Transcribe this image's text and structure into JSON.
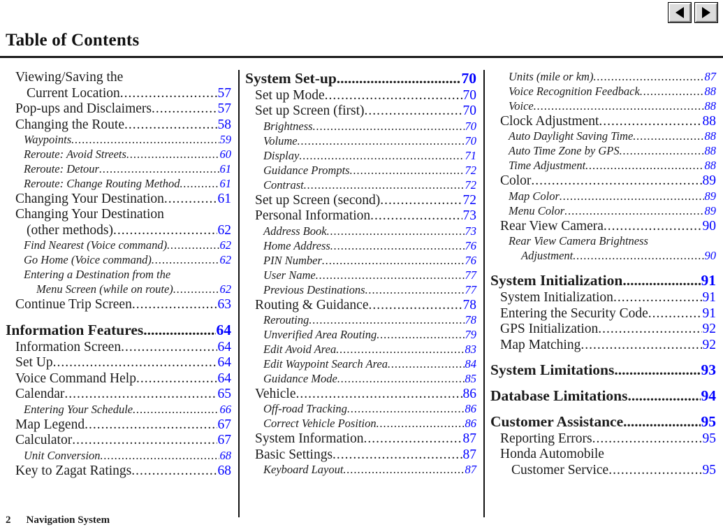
{
  "document": {
    "title": "Table of Contents",
    "footer_page_number": "2",
    "footer_title": "Navigation System"
  },
  "nav": {
    "prev_icon": "triangle-left-icon",
    "next_icon": "triangle-right-icon"
  },
  "colors": {
    "page_number": "#0000FF",
    "text": "#1B1B1B",
    "rule": "#1A1A1A"
  },
  "columns": [
    {
      "id": "column-1",
      "entries": [
        {
          "level": "1",
          "label": "Viewing/Saving the",
          "label2": "Current Location",
          "page": "57",
          "wrapped": true
        },
        {
          "level": "1",
          "label": "Pop-ups and Disclaimers",
          "page": "57"
        },
        {
          "level": "1",
          "label": "Changing the Route",
          "page": "58"
        },
        {
          "level": "2",
          "label": "Waypoints",
          "page": "59"
        },
        {
          "level": "2",
          "label": "Reroute: Avoid Streets",
          "page": "60"
        },
        {
          "level": "2",
          "label": "Reroute: Detour",
          "page": "61"
        },
        {
          "level": "2",
          "label": "Reroute: Change Routing Method",
          "page": "61"
        },
        {
          "level": "1",
          "label": "Changing Your Destination",
          "page": "61"
        },
        {
          "level": "1",
          "label": "Changing Your Destination",
          "label2": "(other methods)",
          "page": "62",
          "wrapped": true
        },
        {
          "level": "2",
          "label": "Find Nearest (Voice command)",
          "page": "62"
        },
        {
          "level": "2",
          "label": "Go Home (Voice command)",
          "page": "62"
        },
        {
          "level": "2",
          "label": "Entering a Destination from the",
          "label2": "Menu Screen (while on route)",
          "page": "62",
          "wrapped": true
        },
        {
          "level": "1",
          "label": "Continue Trip Screen",
          "page": "63"
        },
        {
          "level": "chapter",
          "label": "Information Features",
          "page": "64"
        },
        {
          "level": "1",
          "label": "Information Screen",
          "page": "64"
        },
        {
          "level": "1",
          "label": "Set Up",
          "page": "64"
        },
        {
          "level": "1",
          "label": "Voice Command Help",
          "page": "64"
        },
        {
          "level": "1",
          "label": "Calendar",
          "page": "65"
        },
        {
          "level": "2",
          "label": "Entering Your Schedule",
          "page": "66"
        },
        {
          "level": "1",
          "label": "Map Legend",
          "page": "67"
        },
        {
          "level": "1",
          "label": "Calculator",
          "page": "67"
        },
        {
          "level": "2",
          "label": "Unit Conversion",
          "page": "68"
        },
        {
          "level": "1",
          "label": "Key to Zagat Ratings",
          "page": "68"
        }
      ]
    },
    {
      "id": "column-2",
      "entries": [
        {
          "level": "chapter",
          "label": "System Set-up",
          "page": "70",
          "first": true
        },
        {
          "level": "1",
          "label": "Set up Mode",
          "page": "70"
        },
        {
          "level": "1",
          "label": "Set up Screen (first)",
          "page": "70"
        },
        {
          "level": "2",
          "label": "Brightness",
          "page": "70"
        },
        {
          "level": "2",
          "label": "Volume",
          "page": "70"
        },
        {
          "level": "2",
          "label": "Display",
          "page": "71"
        },
        {
          "level": "2",
          "label": "Guidance Prompts",
          "page": "72"
        },
        {
          "level": "2",
          "label": "Contrast",
          "page": "72"
        },
        {
          "level": "1",
          "label": "Set up Screen (second)",
          "page": "72"
        },
        {
          "level": "1",
          "label": "Personal Information",
          "page": "73"
        },
        {
          "level": "2",
          "label": "Address Book",
          "page": "73"
        },
        {
          "level": "2",
          "label": "Home Address",
          "page": "76"
        },
        {
          "level": "2",
          "label": "PIN Number",
          "page": "76"
        },
        {
          "level": "2",
          "label": "User Name",
          "page": "77"
        },
        {
          "level": "2",
          "label": "Previous Destinations",
          "page": "77"
        },
        {
          "level": "1",
          "label": "Routing & Guidance",
          "page": "78"
        },
        {
          "level": "2",
          "label": "Rerouting",
          "page": "78"
        },
        {
          "level": "2",
          "label": "Unverified Area Routing",
          "page": "79"
        },
        {
          "level": "2",
          "label": "Edit Avoid Area",
          "page": "83"
        },
        {
          "level": "2",
          "label": "Edit Waypoint Search Area",
          "page": "84"
        },
        {
          "level": "2",
          "label": "Guidance Mode",
          "page": "85"
        },
        {
          "level": "1",
          "label": "Vehicle",
          "page": "86"
        },
        {
          "level": "2",
          "label": "Off-road Tracking",
          "page": "86"
        },
        {
          "level": "2",
          "label": "Correct Vehicle Position",
          "page": "86"
        },
        {
          "level": "1",
          "label": "System Information",
          "page": "87"
        },
        {
          "level": "1",
          "label": "Basic Settings",
          "page": "87"
        },
        {
          "level": "2",
          "label": "Keyboard Layout",
          "page": "87"
        }
      ]
    },
    {
      "id": "column-3",
      "entries": [
        {
          "level": "2",
          "label": "Units (mile or km)",
          "page": "87",
          "first": true
        },
        {
          "level": "2",
          "label": "Voice Recognition Feedback",
          "page": "88"
        },
        {
          "level": "2",
          "label": "Voice",
          "page": "88"
        },
        {
          "level": "1",
          "label": "Clock Adjustment",
          "page": "88"
        },
        {
          "level": "2",
          "label": "Auto Daylight Saving Time",
          "page": "88"
        },
        {
          "level": "2",
          "label": "Auto Time Zone by GPS",
          "page": "88"
        },
        {
          "level": "2",
          "label": "Time Adjustment",
          "page": "88"
        },
        {
          "level": "1",
          "label": "Color",
          "page": "89"
        },
        {
          "level": "2",
          "label": "Map Color",
          "page": "89"
        },
        {
          "level": "2",
          "label": "Menu Color",
          "page": "89"
        },
        {
          "level": "1",
          "label": "Rear View Camera",
          "page": "90"
        },
        {
          "level": "2",
          "label": "Rear View Camera Brightness",
          "label2": "Adjustment",
          "page": "90",
          "wrapped": true
        },
        {
          "level": "chapter",
          "label": "System Initialization",
          "page": "91"
        },
        {
          "level": "1",
          "label": "System Initialization",
          "page": "91"
        },
        {
          "level": "1",
          "label": "Entering the Security Code",
          "page": "91"
        },
        {
          "level": "1",
          "label": "GPS Initialization",
          "page": "92"
        },
        {
          "level": "1",
          "label": "Map Matching",
          "page": "92"
        },
        {
          "level": "chapter",
          "label": "System Limitations",
          "page": "93"
        },
        {
          "level": "chapter",
          "label": "Database Limitations",
          "page": "94"
        },
        {
          "level": "chapter",
          "label": "Customer Assistance",
          "page": "95"
        },
        {
          "level": "1",
          "label": "Reporting Errors",
          "page": "95"
        },
        {
          "level": "1",
          "label": "Honda Automobile",
          "label2": "Customer Service",
          "page": "95",
          "wrapped": true
        }
      ]
    }
  ]
}
